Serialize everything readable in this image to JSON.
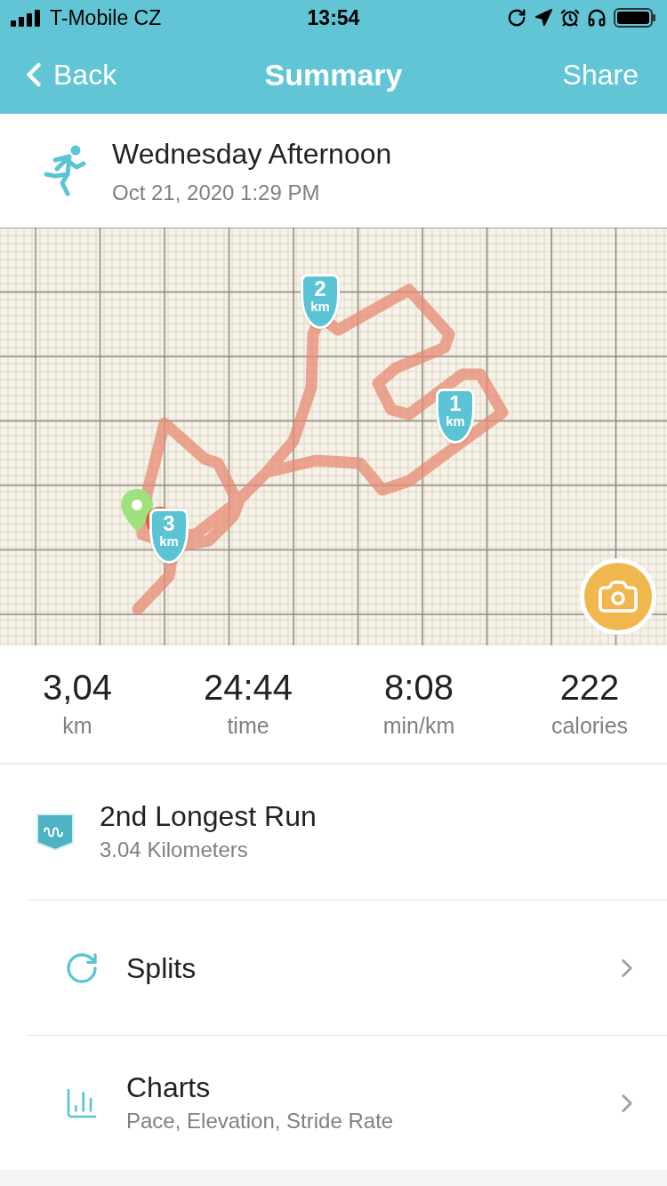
{
  "status_bar": {
    "carrier": "T-Mobile CZ",
    "time": "13:54"
  },
  "nav": {
    "back": "Back",
    "title": "Summary",
    "share": "Share"
  },
  "activity": {
    "title": "Wednesday Afternoon",
    "datetime": "Oct 21, 2020 1:29 PM"
  },
  "map": {
    "kind": "picture",
    "markers": [
      {
        "number": "2",
        "unit": "km"
      },
      {
        "number": "1",
        "unit": "km"
      },
      {
        "number": "3",
        "unit": "km"
      }
    ]
  },
  "stats": [
    {
      "value": "3,04",
      "label": "km"
    },
    {
      "value": "24:44",
      "label": "time"
    },
    {
      "value": "8:08",
      "label": "min/km"
    },
    {
      "value": "222",
      "label": "calories"
    }
  ],
  "rows": [
    {
      "kind": "achievement",
      "title": "2nd Longest Run",
      "subtitle": "3.04 Kilometers"
    },
    {
      "kind": "splits",
      "title": "Splits"
    },
    {
      "kind": "charts",
      "title": "Charts",
      "subtitle": "Pace, Elevation, Stride Rate"
    }
  ]
}
